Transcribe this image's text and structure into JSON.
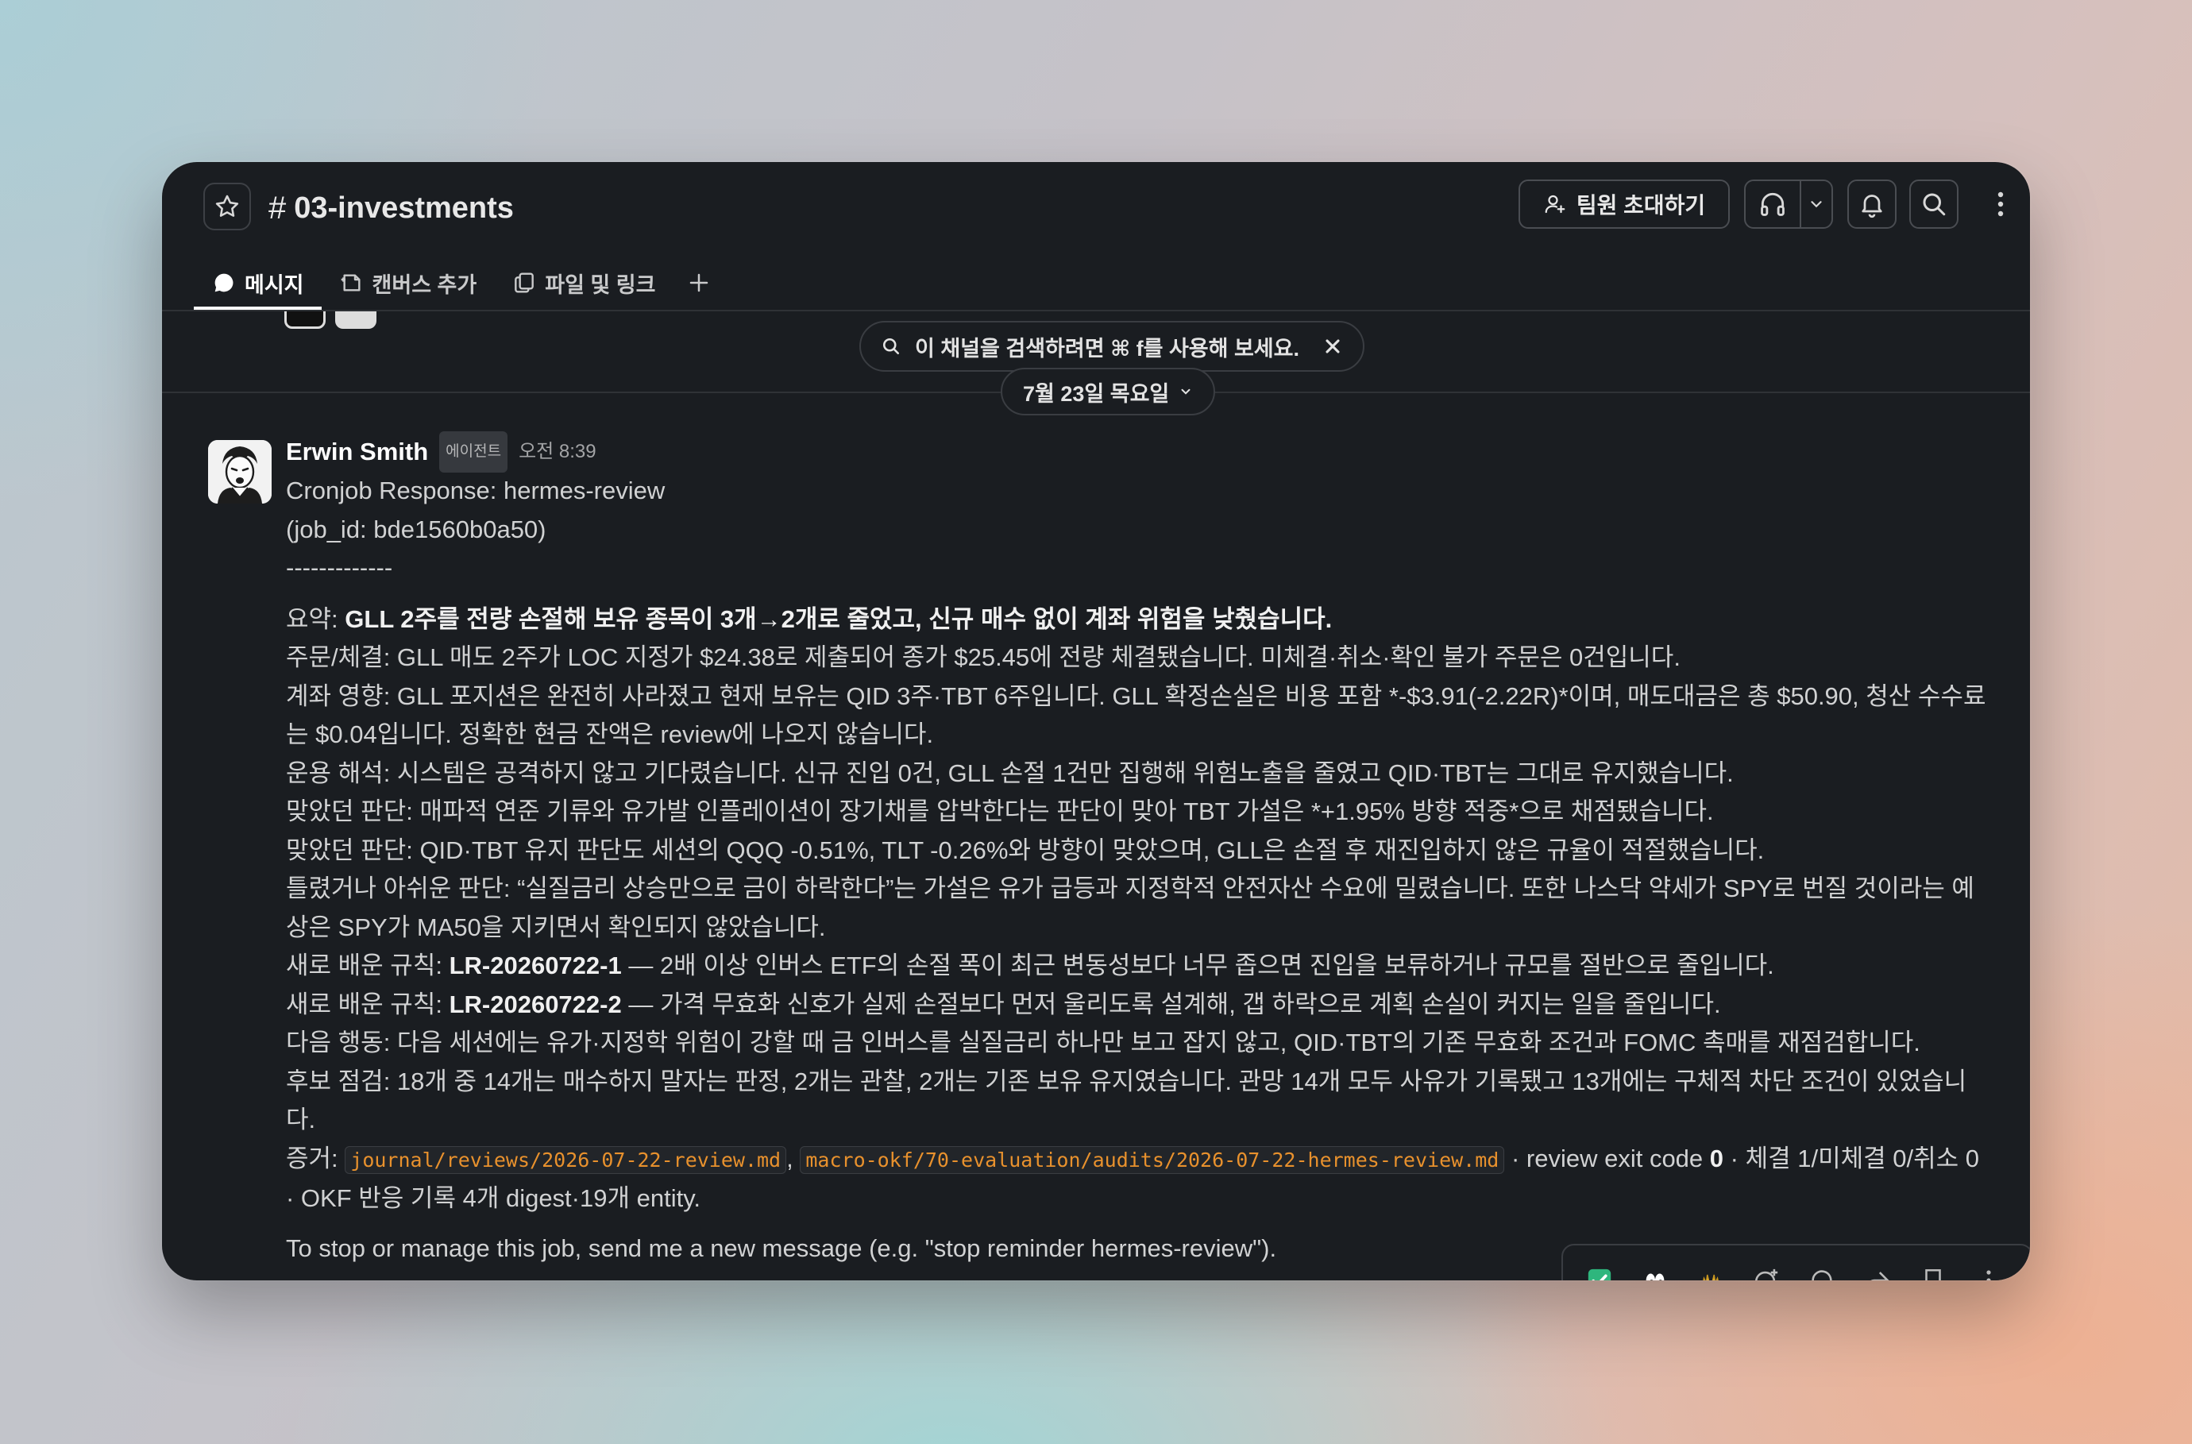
{
  "header": {
    "channel_hash": "#",
    "channel_name": "03-investments",
    "invite_label": "팀원 초대하기"
  },
  "tabs": [
    {
      "label": "메시지",
      "icon": "message-icon"
    },
    {
      "label": "캔버스 추가",
      "icon": "canvas-icon"
    },
    {
      "label": "파일 및 링크",
      "icon": "files-icon"
    }
  ],
  "search_tip": "이 채널을 검색하려면 ⌘ f를 사용해 보세요.",
  "date_divider": "7월 23일 목요일",
  "message": {
    "author": "Erwin Smith",
    "badge": "에이전트",
    "time": "오전 8:39",
    "intro1": "Cronjob Response: hermes-review",
    "intro2": "(job_id: bde1560b0a50)",
    "separator": "-------------",
    "summary_label": "요약: ",
    "summary_bold": "GLL 2주를 전량 손절해 보유 종목이 3개→2개로 줄었고, 신규 매수 없이 계좌 위험을 낮췄습니다.",
    "orders": "주문/체결: GLL 매도 2주가 LOC 지정가 $24.38로 제출되어 종가 $25.45에 전량 체결됐습니다. 미체결·취소·확인 불가 주문은 0건입니다.",
    "account": "계좌 영향: GLL 포지션은 완전히 사라졌고 현재 보유는 QID 3주·TBT 6주입니다. GLL 확정손실은 비용 포함 *-$3.91(-2.22R)*이며, 매도대금은 총 $50.90, 청산 수수료는 $0.04입니다. 정확한 현금 잔액은 review에 나오지 않습니다.",
    "operation": "운용 해석: 시스템은 공격하지 않고 기다렸습니다. 신규 진입 0건, GLL 손절 1건만 집행해 위험노출을 줄였고 QID·TBT는 그대로 유지했습니다.",
    "right1": "맞았던 판단: 매파적 연준 기류와 유가발 인플레이션이 장기채를 압박한다는 판단이 맞아 TBT 가설은 *+1.95% 방향 적중*으로 채점됐습니다.",
    "right2": "맞았던 판단: QID·TBT 유지 판단도 세션의 QQQ -0.51%, TLT -0.26%와 방향이 맞았으며, GLL은 손절 후 재진입하지 않은 규율이 적절했습니다.",
    "wrong": "틀렸거나 아쉬운 판단: “실질금리 상승만으로 금이 하락한다”는 가설은 유가 급등과 지정학적 안전자산 수요에 밀렸습니다. 또한 나스닥 약세가 SPY로 번질 것이라는 예상은 SPY가 MA50을 지키면서 확인되지 않았습니다.",
    "rule1_label": "새로 배운 규칙: ",
    "rule1_id": "LR-20260722-1",
    "rule1_text": " — 2배 이상 인버스 ETF의 손절 폭이 최근 변동성보다 너무 좁으면 진입을 보류하거나 규모를 절반으로 줄입니다.",
    "rule2_label": "새로 배운 규칙: ",
    "rule2_id": "LR-20260722-2",
    "rule2_text": " — 가격 무효화 신호가 실제 손절보다 먼저 울리도록 설계해, 갭 하락으로 계획 손실이 커지는 일을 줄입니다.",
    "next": "다음 행동: 다음 세션에는 유가·지정학 위험이 강할 때 금 인버스를 실질금리 하나만 보고 잡지 않고, QID·TBT의 기존 무효화 조건과 FOMC 촉매를 재점검합니다.",
    "candidates": "후보 점검: 18개 중 14개는 매수하지 말자는 판정, 2개는 관찰, 2개는 기존 보유 유지였습니다. 관망 14개 모두 사유가 기록됐고 13개에는 구체적 차단 조건이 있었습니다.",
    "evidence_label": "증거: ",
    "evidence_file1": "journal/reviews/2026-07-22-review.md",
    "evidence_comma": ", ",
    "evidence_file2": "macro-okf/70-evaluation/audits/2026-07-22-hermes-review.md",
    "evidence_mid": " · review exit code ",
    "evidence_code": "0",
    "evidence_tail": " · 체결 1/미체결 0/취소 0 · OKF 반응 기록 4개 digest·19개 entity.",
    "footer": "To stop or manage this job, send me a new message (e.g. \"stop reminder hermes-review\")."
  },
  "reactions": [
    "check-emoji",
    "eyes-emoji",
    "raised-hands-emoji",
    "add-reaction-icon",
    "reply-icon",
    "share-icon",
    "bookmark-icon",
    "more-icon"
  ]
}
